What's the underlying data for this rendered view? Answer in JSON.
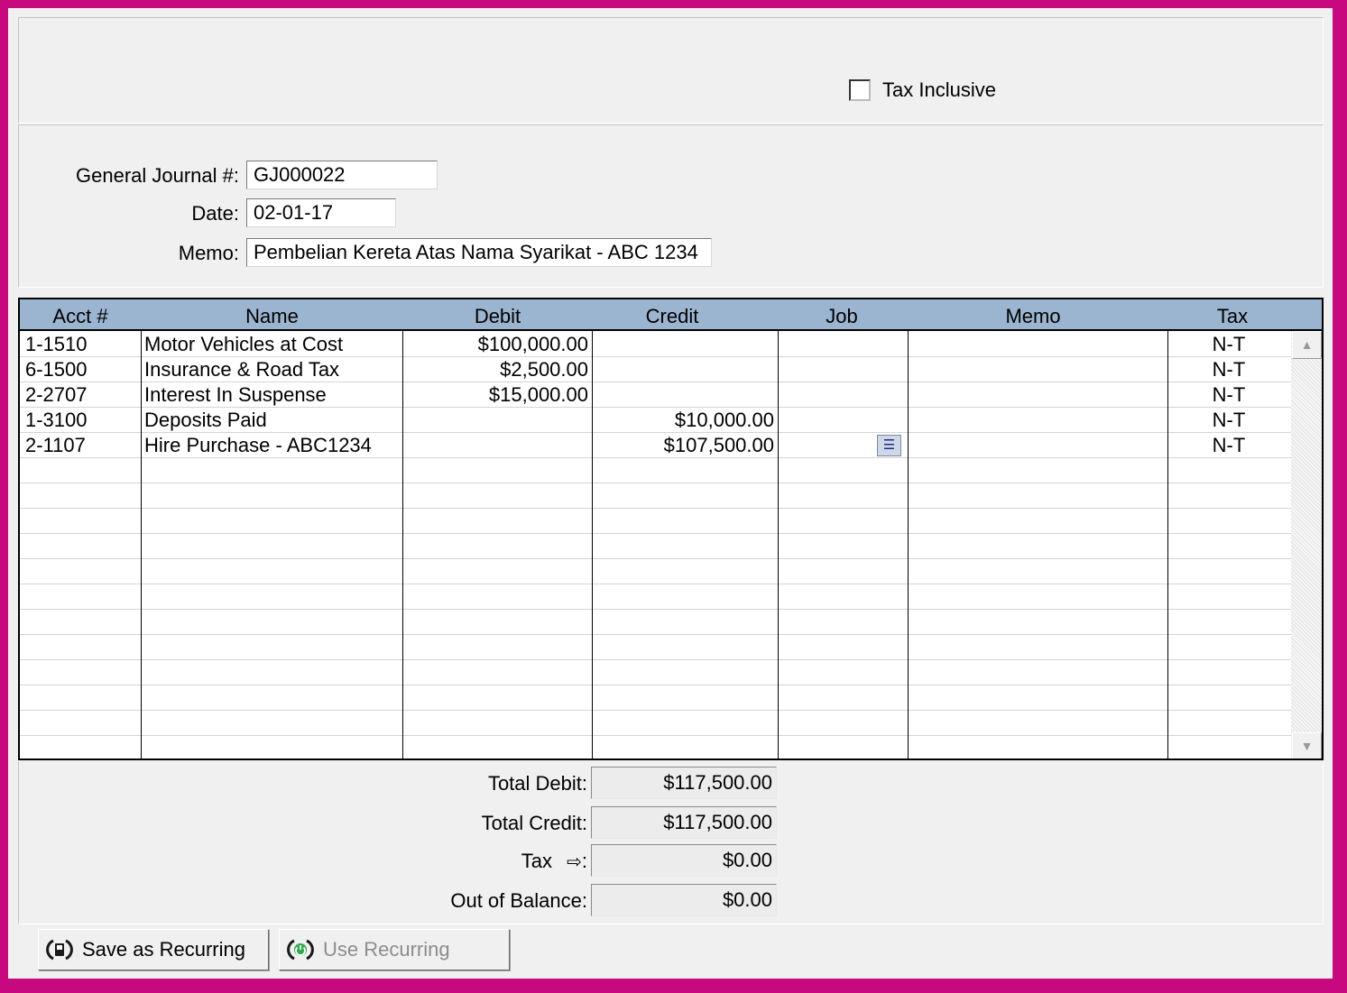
{
  "header": {
    "tax_inclusive_label": "Tax Inclusive",
    "tax_inclusive_checked": false
  },
  "form": {
    "journal_label": "General Journal #:",
    "journal_value": "GJ000022",
    "date_label": "Date:",
    "date_value": "02-01-17",
    "memo_label": "Memo:",
    "memo_value": "Pembelian Kereta Atas Nama Syarikat - ABC 1234"
  },
  "table": {
    "columns": [
      "Acct #",
      "Name",
      "Debit",
      "Credit",
      "Job",
      "Memo",
      "Tax"
    ],
    "rows": [
      {
        "acct": "1-1510",
        "name": "Motor Vehicles at Cost",
        "debit": "$100,000.00",
        "credit": "",
        "job": "",
        "memo": "",
        "tax": "N-T"
      },
      {
        "acct": "6-1500",
        "name": "Insurance & Road Tax",
        "debit": "$2,500.00",
        "credit": "",
        "job": "",
        "memo": "",
        "tax": "N-T"
      },
      {
        "acct": "2-2707",
        "name": "Interest In Suspense",
        "debit": "$15,000.00",
        "credit": "",
        "job": "",
        "memo": "",
        "tax": "N-T"
      },
      {
        "acct": "1-3100",
        "name": "Deposits Paid",
        "debit": "",
        "credit": "$10,000.00",
        "job": "",
        "memo": "",
        "tax": "N-T"
      },
      {
        "acct": "2-1107",
        "name": "Hire Purchase - ABC1234",
        "debit": "",
        "credit": "$107,500.00",
        "job": "",
        "memo": "",
        "tax": "N-T"
      }
    ],
    "empty_rows": 12
  },
  "totals": {
    "total_debit_label": "Total Debit:",
    "total_debit_value": "$117,500.00",
    "total_credit_label": "Total Credit:",
    "total_credit_value": "$117,500.00",
    "tax_label": "Tax",
    "tax_value": "$0.00",
    "out_of_balance_label": "Out of Balance:",
    "out_of_balance_value": "$0.00"
  },
  "buttons": {
    "save_recurring_label": "Save as Recurring",
    "use_recurring_label": "Use Recurring"
  },
  "icons": {
    "tax_arrow": "arrow-right-icon",
    "job_list": "list-dropdown-icon",
    "save_recurring": "recurring-save-icon",
    "use_recurring": "recurring-use-icon"
  },
  "colors": {
    "frame": "#c8087e",
    "grid_header": "#9bb4cf",
    "panel": "#f0f0f0"
  }
}
